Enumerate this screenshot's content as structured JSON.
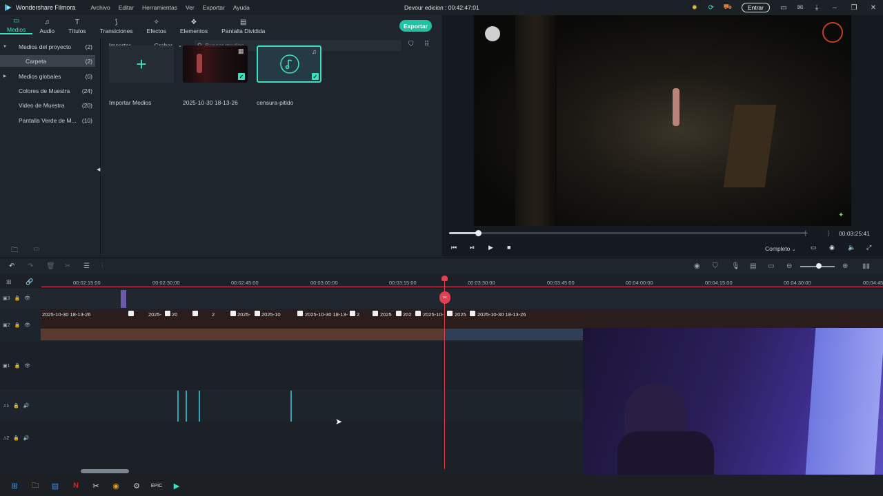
{
  "app": {
    "name": "Wondershare Filmora",
    "project_title": "Devour edicion : 00:42:47:01",
    "menu": [
      "Archivo",
      "Editar",
      "Herramientas",
      "Ver",
      "Exportar",
      "Ayuda"
    ],
    "entrar_label": "Entrar"
  },
  "tabs": [
    {
      "label": "Medios",
      "icon": "folder-icon"
    },
    {
      "label": "Audio",
      "icon": "music-icon"
    },
    {
      "label": "Títulos",
      "icon": "title-icon"
    },
    {
      "label": "Transiciones",
      "icon": "transition-icon"
    },
    {
      "label": "Efectos",
      "icon": "effects-icon"
    },
    {
      "label": "Elementos",
      "icon": "elements-icon"
    },
    {
      "label": "Pantalla Dividida",
      "icon": "split-screen-icon"
    }
  ],
  "export_label": "Exportar",
  "sidebar": {
    "items": [
      {
        "label": "Medios del proyecto",
        "count": "(2)"
      },
      {
        "label": "Carpeta",
        "count": "(2)"
      },
      {
        "label": "Medios globales",
        "count": "(0)"
      },
      {
        "label": "Colores de Muestra",
        "count": "(24)"
      },
      {
        "label": "Video de Muestra",
        "count": "(20)"
      },
      {
        "label": "Pantalla Verde de M...",
        "count": "(10)"
      }
    ]
  },
  "media_toolbar": {
    "import_label": "Importar",
    "record_label": "Grabar",
    "search_placeholder": "Buscar medios"
  },
  "media": {
    "import_label": "Importar Medios",
    "video_label": "2025-10-30 18-13-26",
    "audio_label": "censura-pitido"
  },
  "preview": {
    "timecode": "00:03:25:41",
    "quality": "Completo",
    "progress_fraction": 0.08
  },
  "timeline": {
    "ticks": [
      "00:02:15:00",
      "00:02:30:00",
      "00:02:45:00",
      "00:03:00:00",
      "00:03:15:00",
      "00:03:30:00",
      "00:03:45:00",
      "00:04:00:00",
      "00:04:15:00",
      "00:04:30:00",
      "00:04:45"
    ],
    "track_labels": [
      "3",
      "2",
      "1",
      "1",
      "2"
    ],
    "clip_labels": [
      "2025-10-30 18-13-26",
      "2025-",
      "20",
      "2",
      "2025-",
      "2025-10",
      "2025-10-30 18-13-",
      "2",
      "2025",
      "202",
      "2025-10-",
      "2025",
      "2025-10-30 18-13-26"
    ]
  },
  "colors": {
    "accent": "#3fe0c0",
    "playhead": "#e0404f",
    "export_button": "#1fc2a2"
  }
}
